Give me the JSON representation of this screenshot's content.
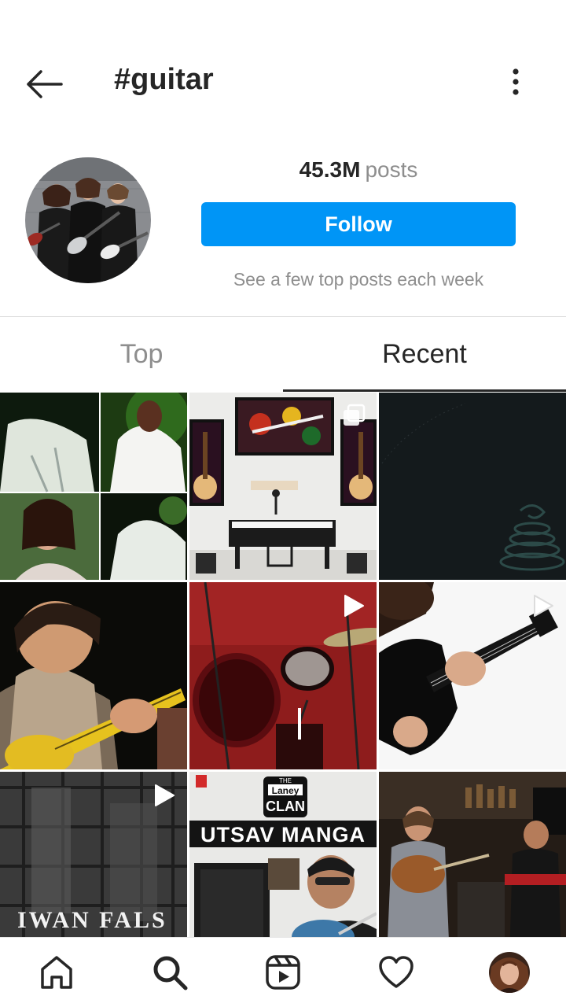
{
  "header": {
    "title": "#guitar",
    "back_icon": "arrow-left-icon",
    "more_icon": "more-vertical-icon"
  },
  "profile": {
    "post_count": "45.3M",
    "post_unit": "posts",
    "follow_label": "Follow",
    "hint": "See a few top posts each week"
  },
  "tabs": [
    {
      "label": "Top",
      "active": false
    },
    {
      "label": "Recent",
      "active": true
    }
  ],
  "grid": {
    "posts": [
      {
        "type": "collage"
      },
      {
        "type": "image",
        "badge": "multi-image-icon"
      },
      {
        "type": "image"
      },
      {
        "type": "image"
      },
      {
        "type": "video",
        "badge": "play-icon"
      },
      {
        "type": "video",
        "badge": "play-icon"
      },
      {
        "type": "video",
        "badge": "play-icon",
        "caption": "IWAN FALS"
      },
      {
        "type": "image",
        "caption_top": "THE",
        "brand": "Laney",
        "brand2": "CLAN",
        "title": "UTSAV MANGA"
      },
      {
        "type": "image"
      }
    ]
  },
  "bottom_nav": [
    {
      "icon": "home-icon"
    },
    {
      "icon": "search-icon"
    },
    {
      "icon": "reels-icon"
    },
    {
      "icon": "heart-icon"
    },
    {
      "icon": "profile-avatar"
    }
  ],
  "colors": {
    "accent": "#0095f6",
    "text": "#262626",
    "muted": "#8e8e8e",
    "divider": "#dbdbdb"
  }
}
